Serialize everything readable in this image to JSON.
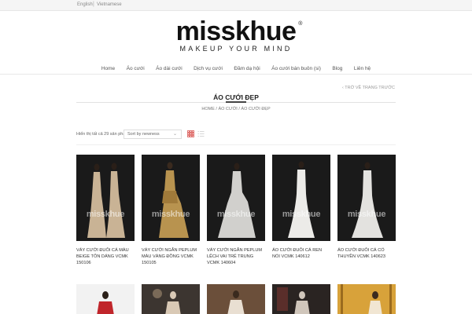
{
  "topbar": {
    "lang_en": "English",
    "separator": "|",
    "lang_vi": "Vietnamese"
  },
  "logo": {
    "text": "misskhue",
    "reg": "®",
    "tagline": "MAKEUP YOUR MIND"
  },
  "nav": [
    {
      "label": "Home"
    },
    {
      "label": "Áo cưới"
    },
    {
      "label": "Áo dài cưới"
    },
    {
      "label": "Dịch vụ cưới"
    },
    {
      "label": "Đầm dạ hội"
    },
    {
      "label": "Áo cưới bán buôn (si)"
    },
    {
      "label": "Blog"
    },
    {
      "label": "Liên hệ"
    }
  ],
  "back_link": "‹ TRỞ VỀ TRANG TRƯỚC",
  "page_title": "ÁO CƯỚI ĐẸP",
  "breadcrumb": "HOME / ÁO CƯỚI / ÁO CƯỚI ĐẸP",
  "toolbar": {
    "result_count": "Hiển thị tất cả 29 sản phẩm",
    "sort_value": "Sort by newness",
    "sort_chevron": "⌄"
  },
  "watermark": "misskhue",
  "colors": {
    "gown_gold": "#c8a46e",
    "gown_white": "#e9e6e0",
    "background_dark": "#141414",
    "gown_champagne": "#d9c3a4"
  },
  "products": [
    {
      "name": "VÁY CƯỚI ĐUÔI CÁ MÀU BEIGE TÔN DÁNG VCMK 150106",
      "gown": "#c9b395"
    },
    {
      "name": "VÁY CƯỚI NGẮN PEPLUM MÀU VÀNG ĐỒNG VCMK 150105",
      "gown": "#b8934f"
    },
    {
      "name": "VÁY CƯỚI NGẮN PEPLUM LỆCH VAI TRẺ TRUNG VCMK 140604",
      "gown": "#e6e4e1"
    },
    {
      "name": "ÁO CƯỚI ĐUÔI CÁ REN NỔI VCMK 140612",
      "gown": "#ecebe8"
    },
    {
      "name": "ÁO CƯỚI ĐUÔI CÁ CỔ THUYỀN VCMK 140623",
      "gown": "#e3e2df"
    }
  ],
  "row2": [
    {
      "bg": "#f2f2f2",
      "accent": "#c0262b"
    },
    {
      "bg": "#3c3530",
      "accent": "#d9c9b5"
    },
    {
      "bg": "#6b4f3a",
      "accent": "#e9dfd2"
    },
    {
      "bg": "#2a2422",
      "accent": "#d0c6bb"
    },
    {
      "bg": "#d8a23a",
      "accent": "#f1e6d3"
    }
  ]
}
